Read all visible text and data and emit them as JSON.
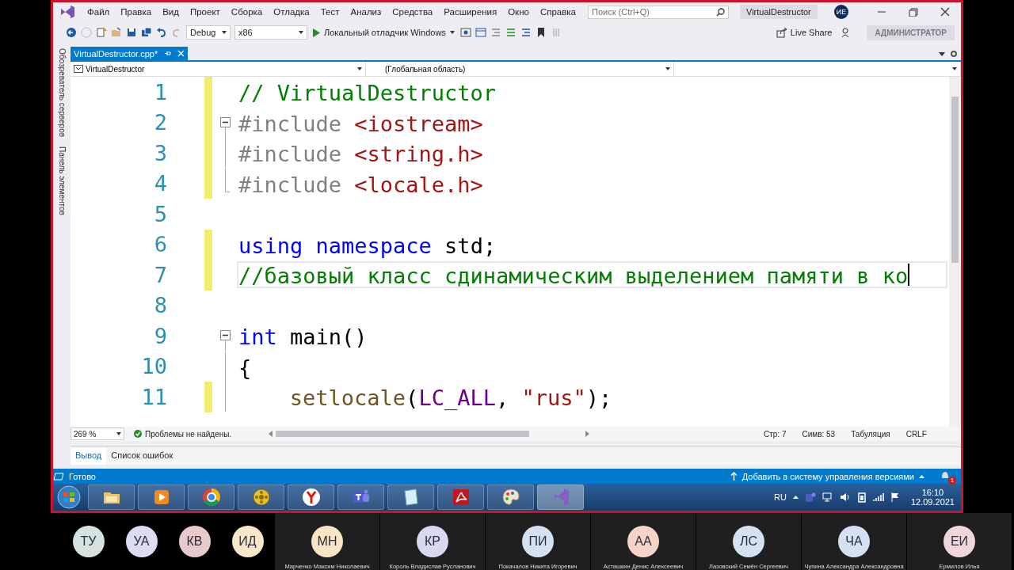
{
  "window": {
    "menu": [
      "Файл",
      "Правка",
      "Вид",
      "Проект",
      "Сборка",
      "Отладка",
      "Тест",
      "Анализ",
      "Средства",
      "Расширения",
      "Окно",
      "Справка"
    ],
    "search": {
      "placeholder": "Поиск (Ctrl+Q)"
    },
    "project": "VirtualDestructor",
    "user_initials": "ИЕ"
  },
  "toolbar": {
    "configuration": "Debug",
    "platform": "x86",
    "run": "Локальный отладчик Windows",
    "live_share": "Live Share",
    "role": "АДМИНИСТРАТОР"
  },
  "side_tabs": [
    "Обозреватель серверов",
    "Панель элементов"
  ],
  "tabs": [
    {
      "label": "VirtualDestructor.cpp*",
      "selected": true
    }
  ],
  "navigation": {
    "project": "VirtualDestructor",
    "scope": "(Глобальная область)"
  },
  "editor": {
    "lines": [
      {
        "number": "1",
        "changed": true,
        "collapsible": false,
        "in_block": false,
        "block_end": false,
        "indented": false,
        "current": false,
        "tokens": [
          {
            "kind": "comment",
            "text": "// VirtualDestructor"
          }
        ]
      },
      {
        "number": "2",
        "changed": true,
        "collapsible": true,
        "in_block": false,
        "block_end": false,
        "indented": false,
        "current": false,
        "tokens": [
          {
            "kind": "preprocessor",
            "text": "#include "
          },
          {
            "kind": "include",
            "text": "<iostream>"
          }
        ]
      },
      {
        "number": "3",
        "changed": true,
        "collapsible": false,
        "in_block": true,
        "block_end": false,
        "indented": false,
        "current": false,
        "tokens": [
          {
            "kind": "preprocessor",
            "text": "#include "
          },
          {
            "kind": "include",
            "text": "<string.h>"
          }
        ]
      },
      {
        "number": "4",
        "changed": true,
        "collapsible": false,
        "in_block": false,
        "block_end": true,
        "indented": false,
        "current": false,
        "tokens": [
          {
            "kind": "preprocessor",
            "text": "#include "
          },
          {
            "kind": "include",
            "text": "<locale.h>"
          }
        ]
      },
      {
        "number": "5",
        "changed": false,
        "collapsible": false,
        "in_block": false,
        "block_end": false,
        "indented": false,
        "current": false
      },
      {
        "number": "6",
        "changed": true,
        "collapsible": false,
        "in_block": false,
        "block_end": false,
        "indented": false,
        "current": false,
        "tokens": [
          {
            "kind": "keyword",
            "text": "using "
          },
          {
            "kind": "keyword",
            "text": "namespace"
          },
          {
            "kind": "plain",
            "text": " std;"
          }
        ]
      },
      {
        "number": "7",
        "changed": true,
        "collapsible": false,
        "in_block": false,
        "block_end": false,
        "indented": false,
        "current": true,
        "tokens": [
          {
            "kind": "comment",
            "text": "//базовый класс сдинамическим выделением памяти в ко"
          }
        ]
      },
      {
        "number": "8",
        "changed": false,
        "collapsible": false,
        "in_block": false,
        "block_end": false,
        "indented": false,
        "current": false
      },
      {
        "number": "9",
        "changed": false,
        "collapsible": true,
        "in_block": false,
        "block_end": false,
        "indented": false,
        "current": false,
        "tokens": [
          {
            "kind": "keyword",
            "text": "int"
          },
          {
            "kind": "plain",
            "text": " main()"
          }
        ]
      },
      {
        "number": "10",
        "changed": false,
        "collapsible": false,
        "in_block": true,
        "block_end": false,
        "indented": false,
        "current": false,
        "tokens": [
          {
            "kind": "plain",
            "text": "{"
          }
        ]
      },
      {
        "number": "11",
        "changed": true,
        "collapsible": false,
        "in_block": true,
        "block_end": false,
        "indented": true,
        "current": false,
        "tokens": [
          {
            "kind": "function",
            "text": "setlocale"
          },
          {
            "kind": "plain",
            "text": "("
          },
          {
            "kind": "macro",
            "text": "LC_ALL"
          },
          {
            "kind": "plain",
            "text": ", "
          },
          {
            "kind": "string",
            "text": "\"rus\""
          },
          {
            "kind": "plain",
            "text": ");"
          }
        ]
      }
    ]
  },
  "editor_status": {
    "zoom": "269 %",
    "issues": "Проблемы не найдены.",
    "line": "Стр: 7",
    "column": "Симв: 53",
    "indent": "Табуляция",
    "line_ending": "CRLF"
  },
  "output_tabs": [
    {
      "label": "Вывод",
      "selected": true
    },
    {
      "label": "Список ошибок",
      "selected": false
    }
  ],
  "status_bar": {
    "state": "Готово",
    "source_control": "Добавить в систему управления версиями",
    "notifications": "1"
  },
  "taskbar": {
    "apps": [
      {
        "kind": "folder",
        "active": false
      },
      {
        "kind": "player",
        "active": false
      },
      {
        "kind": "browser",
        "active": false
      },
      {
        "kind": "reel",
        "active": false
      },
      {
        "kind": "yandex",
        "active": false
      },
      {
        "kind": "teams",
        "active": false
      },
      {
        "kind": "notepad",
        "active": false
      },
      {
        "kind": "pdf",
        "active": false
      },
      {
        "kind": "paint",
        "active": false
      },
      {
        "kind": "studio",
        "active": true
      }
    ],
    "language": "RU",
    "time": "16:10",
    "date": "12.09.2021"
  },
  "participants": [
    {
      "initials": "ТУ",
      "color": "#d5e3e0"
    },
    {
      "initials": "УА",
      "color": "#dcdcf0"
    },
    {
      "initials": "КВ",
      "color": "#e8c9cc"
    },
    {
      "initials": "ИД",
      "color": "#f8e6c8"
    },
    {
      "initials": "МН",
      "name": "Марченко Максим Николаевич",
      "color": "#f9e4c4"
    },
    {
      "initials": "КР",
      "name": "Король Владислав Русланович",
      "color": "#d8d9f0"
    },
    {
      "initials": "ПИ",
      "name": "Покачалов Никита Игоревич",
      "color": "#d3e1f0"
    },
    {
      "initials": "АА",
      "name": "Асташкин Денис Алексеевич",
      "color": "#f7d4c8"
    },
    {
      "initials": "ЛС",
      "name": "Лазовский Семён Сергеевич",
      "color": "#d3e1f1"
    },
    {
      "initials": "ЧА",
      "name": "Чупина Александра Александровна",
      "color": "#d3e1f2"
    },
    {
      "initials": "ЕИ",
      "name": "Ермилов Илья",
      "color": "#f0d6d8"
    }
  ]
}
